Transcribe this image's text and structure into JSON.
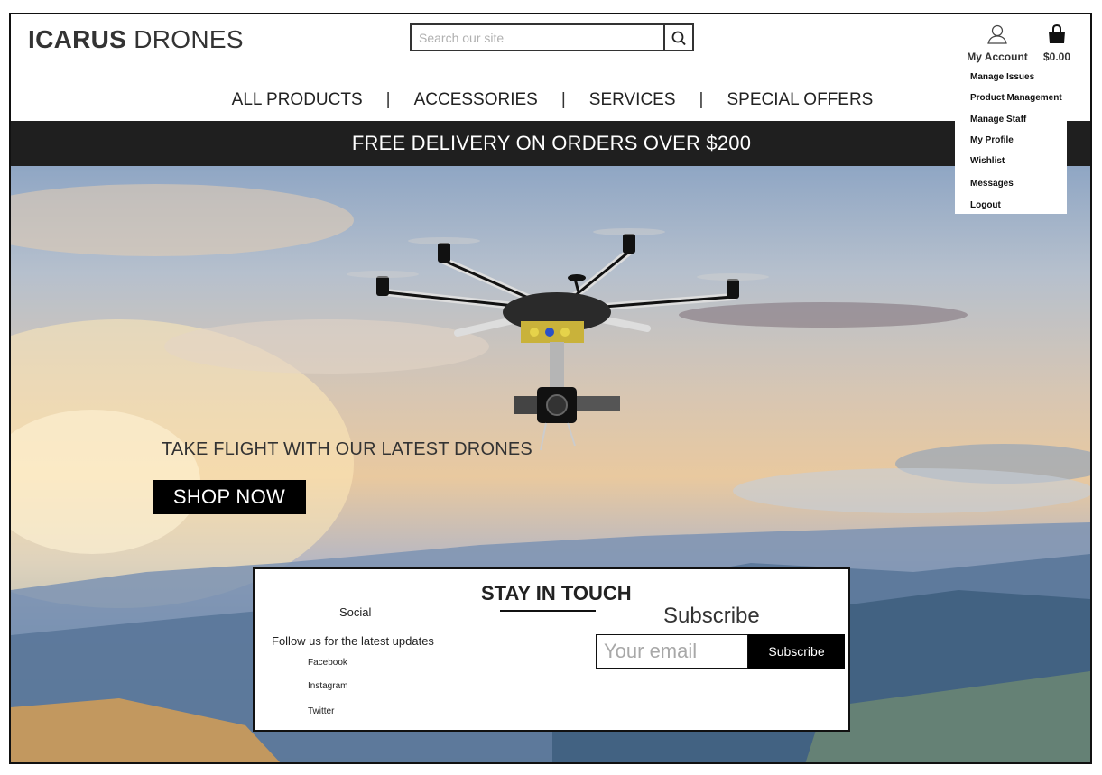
{
  "header": {
    "logo_bold": "ICARUS",
    "logo_light": "DRONES",
    "search_placeholder": "Search our site",
    "account_label": "My Account",
    "cart_total": "$0.00"
  },
  "nav": {
    "items": [
      "ALL PRODUCTS",
      "ACCESSORIES",
      "SERVICES",
      "SPECIAL OFFERS"
    ],
    "separator": "|"
  },
  "banner": {
    "text": "FREE DELIVERY ON ORDERS OVER $200"
  },
  "hero": {
    "tagline": "TAKE FLIGHT WITH OUR LATEST DRONES",
    "cta": "SHOP NOW"
  },
  "contact": {
    "title": "STAY IN TOUCH",
    "social_title": "Social",
    "social_desc": "Follow us for the latest updates",
    "links": [
      "Facebook",
      "Instagram",
      "Twitter"
    ],
    "subscribe_title": "Subscribe",
    "email_placeholder": "Your email",
    "subscribe_button": "Subscribe"
  },
  "account_menu": {
    "items": [
      "Manage Issues",
      "Product Management",
      "Manage Staff",
      "My Profile",
      "Wishlist",
      "Messages",
      "Logout"
    ]
  },
  "icons": {
    "search": "magnifier-icon",
    "account": "user-icon",
    "cart": "shopping-bag-icon",
    "hero_image": "hexacopter-drone-image"
  }
}
